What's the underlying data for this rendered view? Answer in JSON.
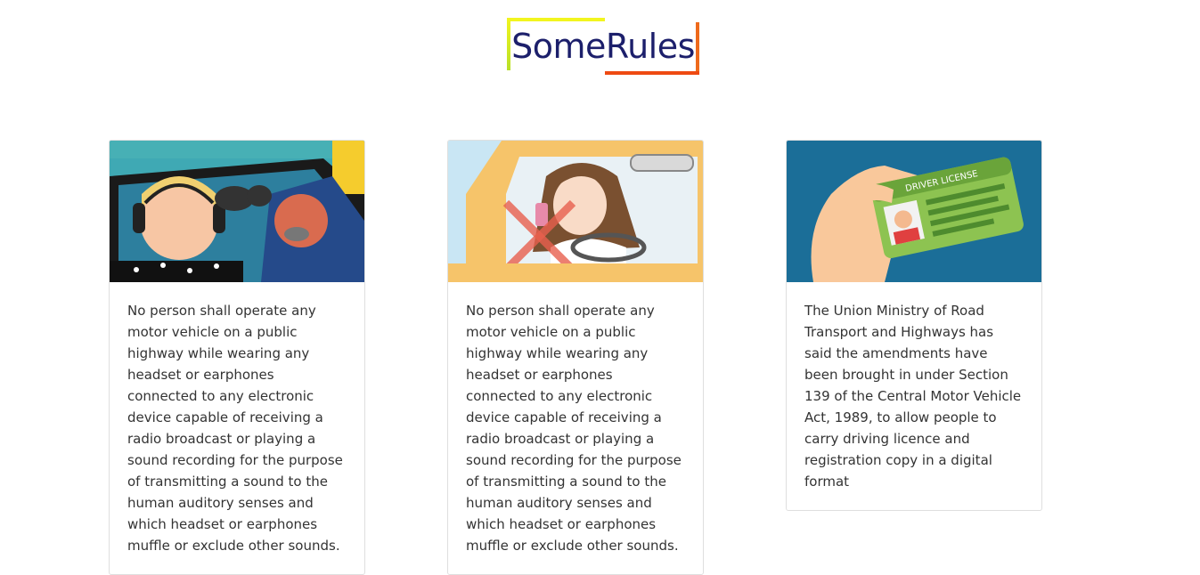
{
  "header": {
    "title": "SomeRules"
  },
  "cards": [
    {
      "image_icon": "headphones-driver-police-illustration",
      "text": "No person shall operate any motor vehicle on a public highway while wearing any headset or earphones connected to any electronic device capable of receiving a radio broadcast or playing a sound recording for the purpose of transmitting a sound to the human auditory senses and which headset or earphones muffle or exclude other sounds."
    },
    {
      "image_icon": "phone-while-driving-prohibited-illustration",
      "text": "No person shall operate any motor vehicle on a public highway while wearing any headset or earphones connected to any electronic device capable of receiving a radio broadcast or playing a sound recording for the purpose of transmitting a sound to the human auditory senses and which headset or earphones muffle or exclude other sounds."
    },
    {
      "image_icon": "driver-license-hand-illustration",
      "text": "The Union Ministry of Road Transport and Highways has said the amendments have been brought in under Section 139 of the Central Motor Vehicle Act, 1989, to allow people to carry driving licence and registration copy in a digital format"
    }
  ],
  "colors": {
    "title": "#1c1f6b",
    "border_top": "#f2f51f",
    "border_bottom": "#ee4a12"
  }
}
